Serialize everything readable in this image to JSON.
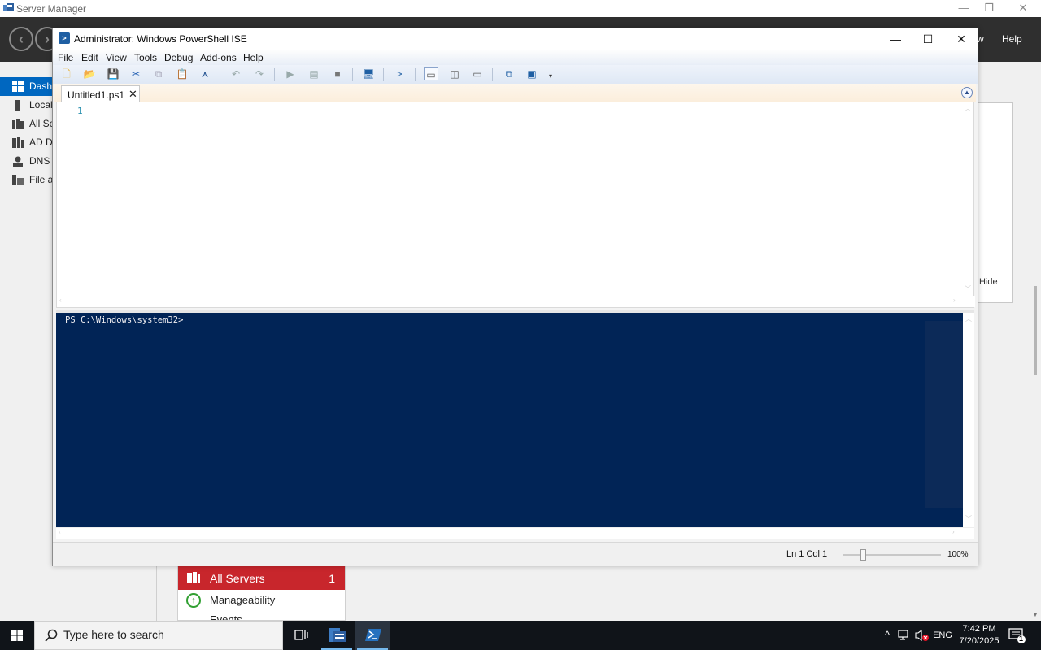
{
  "server_manager": {
    "title": "Server Manager",
    "menu_view": "w",
    "menu_help": "Help",
    "sidebar": [
      {
        "label": "Dash",
        "active": true,
        "icon": "dashboard-icon"
      },
      {
        "label": "Local",
        "active": false,
        "icon": "local-server-icon"
      },
      {
        "label": "All Se",
        "active": false,
        "icon": "all-servers-icon"
      },
      {
        "label": "AD D",
        "active": false,
        "icon": "ad-ds-icon"
      },
      {
        "label": "DNS",
        "active": false,
        "icon": "dns-icon"
      },
      {
        "label": "File a",
        "active": false,
        "icon": "file-storage-icon"
      }
    ],
    "hide_label": "Hide",
    "tile": {
      "title": "All Servers",
      "count": "1",
      "rows": [
        "Manageability",
        "Events"
      ]
    }
  },
  "ise": {
    "title": "Administrator: Windows PowerShell ISE",
    "menus": [
      "File",
      "Edit",
      "View",
      "Tools",
      "Debug",
      "Add-ons",
      "Help"
    ],
    "tab": {
      "label": "Untitled1.ps1",
      "close": "✕"
    },
    "editor": {
      "line_number": "1"
    },
    "console": {
      "prompt": "PS C:\\Windows\\system32>"
    },
    "status": {
      "position": "Ln 1  Col 1",
      "zoom": "100%",
      "zoom_level": 100
    }
  },
  "taskbar": {
    "search_placeholder": "Type here to search",
    "tray": {
      "language": "ENG",
      "time": "7:42 PM",
      "date": "7/20/2025",
      "notification_count": "1"
    }
  },
  "colors": {
    "console_bg": "#012456",
    "console_fg": "#eeedf0",
    "accent": "#0067c0",
    "tile_header": "#c8262c",
    "taskbar": "#101419"
  }
}
